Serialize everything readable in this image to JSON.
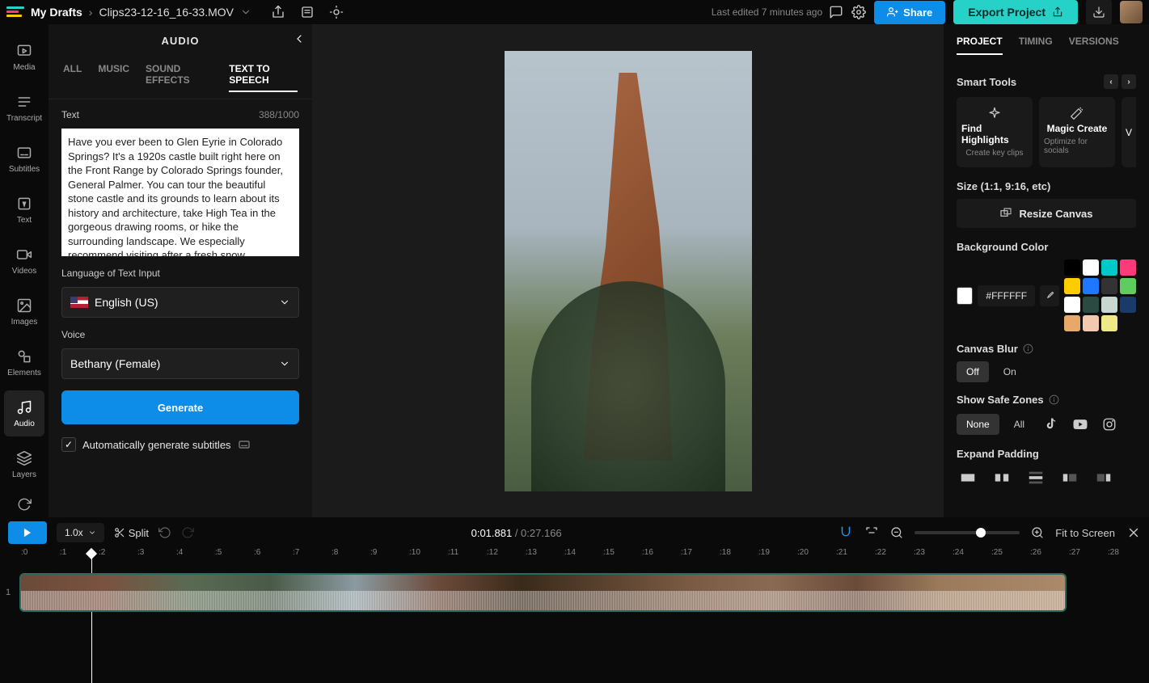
{
  "breadcrumb": {
    "project": "My Drafts",
    "file": "Clips23-12-16_16-33.MOV"
  },
  "last_edited": "Last edited 7 minutes ago",
  "share_label": "Share",
  "export_label": "Export Project",
  "rail": [
    {
      "label": "Media"
    },
    {
      "label": "Transcript"
    },
    {
      "label": "Subtitles"
    },
    {
      "label": "Text"
    },
    {
      "label": "Videos"
    },
    {
      "label": "Images"
    },
    {
      "label": "Elements"
    },
    {
      "label": "Audio"
    },
    {
      "label": "Layers"
    }
  ],
  "panel": {
    "title": "AUDIO",
    "tabs": [
      "ALL",
      "MUSIC",
      "SOUND EFFECTS",
      "TEXT TO SPEECH"
    ],
    "text_label": "Text",
    "counter": "388/1000",
    "text_value": "Have you ever been to Glen Eyrie in Colorado Springs? It's a 1920s castle built right here on the Front Range by Colorado Springs founder, General Palmer. You can tour the beautiful stone castle and its grounds to learn about its history and architecture, take High Tea in the gorgeous drawing rooms, or hike the surrounding landscape. We especially recommend visiting after a fresh snow",
    "lang_label": "Language of Text Input",
    "lang_value": "English (US)",
    "voice_label": "Voice",
    "voice_value": "Bethany (Female)",
    "generate_label": "Generate",
    "subtitle_check": "Automatically generate subtitles"
  },
  "right": {
    "tabs": [
      "PROJECT",
      "TIMING",
      "VERSIONS"
    ],
    "smart_header": "Smart Tools",
    "cards": [
      {
        "title": "Find Highlights",
        "sub": "Create key clips"
      },
      {
        "title": "Magic Create",
        "sub": "Optimize for socials"
      }
    ],
    "partial_card": "V",
    "size_label": "Size (1:1, 9:16, etc)",
    "resize_label": "Resize Canvas",
    "bgcolor_label": "Background Color",
    "hex": "#FFFFFF",
    "palette": [
      "#000000",
      "#ffffff",
      "#00c8c8",
      "#ff3a7a",
      "#ffcc00",
      "#1e78ff",
      "#333333",
      "#5ecc5e",
      "#ffffff",
      "#2a4a42",
      "#c8d8d0",
      "#1a3a6a",
      "#e8a86a",
      "#f2c8b0",
      "#eee888"
    ],
    "blur_label": "Canvas Blur",
    "blur_off": "Off",
    "blur_on": "On",
    "zones_label": "Show Safe Zones",
    "zones_none": "None",
    "zones_all": "All",
    "padding_label": "Expand Padding"
  },
  "tl": {
    "speed": "1.0x",
    "split": "Split",
    "cur_time": "0:01.881",
    "total_time": " / 0:27.166",
    "fit": "Fit to Screen",
    "ticks": [
      ":0",
      ":1",
      ":2",
      ":3",
      ":4",
      ":5",
      ":6",
      ":7",
      ":8",
      ":9",
      ":10",
      ":11",
      ":12",
      ":13",
      ":14",
      ":15",
      ":16",
      ":17",
      ":18",
      ":19",
      ":20",
      ":21",
      ":22",
      ":23",
      ":24",
      ":25",
      ":26",
      ":27",
      ":28"
    ],
    "track_num": "1"
  }
}
